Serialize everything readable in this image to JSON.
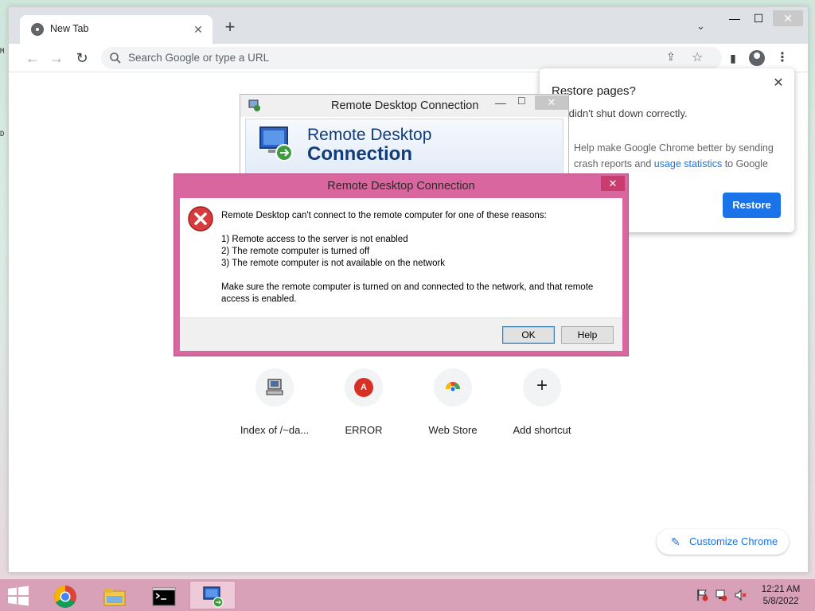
{
  "browser": {
    "tab": {
      "title": "New Tab",
      "close_glyph": "✕"
    },
    "new_tab_glyph": "+",
    "tab_search_glyph": "⌄",
    "window_controls": {
      "minimize": "—",
      "maximize": "☐",
      "close": "✕"
    },
    "omnibox": {
      "placeholder": "Search Google or type a URL"
    },
    "nav": {
      "back": "←",
      "forward": "→",
      "reload": "↻"
    },
    "icons": {
      "share": "⇪",
      "bookmark": "☆",
      "side_panel": "▮",
      "menu": "⋮"
    }
  },
  "ntp": {
    "shortcuts": [
      {
        "label": "Index of /~da...",
        "icon": "computer-icon"
      },
      {
        "label": "ERROR",
        "icon": "letter-a-icon",
        "badge": "A"
      },
      {
        "label": "Web Store",
        "icon": "chrome-web-store-icon"
      },
      {
        "label": "Add shortcut",
        "icon": "plus-icon",
        "glyph": "+"
      }
    ],
    "customize_label": "Customize Chrome",
    "customize_glyph": "✎"
  },
  "restore_popup": {
    "title": "Restore pages?",
    "message": "me didn't shut down correctly.",
    "help_prefix": "Help make Google Chrome better by sending crash reports and ",
    "help_link": "usage statistics",
    "help_suffix": " to Google",
    "button": "Restore",
    "close_glyph": "✕"
  },
  "rdc_window": {
    "title": "Remote Desktop Connection",
    "banner_line1": "Remote Desktop",
    "banner_line2": "Connection",
    "controls": {
      "minimize": "—",
      "maximize": "☐",
      "close": "✕"
    }
  },
  "error_dialog": {
    "title": "Remote Desktop Connection",
    "close_glyph": "✕",
    "intro": "Remote Desktop can't connect to the remote computer for one of these reasons:",
    "reasons": [
      "1) Remote access to the server is not enabled",
      "2) The remote computer is turned off",
      "3) The remote computer is not available on the network"
    ],
    "advice_line1": "Make sure the remote computer is turned on and connected to the network, and that remote",
    "advice_line2": "access is enabled.",
    "ok_label": "OK",
    "help_label": "Help"
  },
  "taskbar": {
    "apps": [
      "chrome-icon",
      "file-explorer-icon",
      "command-prompt-icon",
      "remote-desktop-icon"
    ],
    "tray": [
      "action-center-flag-icon",
      "network-icon",
      "volume-muted-icon"
    ],
    "time": "12:21 AM",
    "date": "5/8/2022"
  },
  "desktop": {
    "edge_glyph_1": "M",
    "edge_glyph_2": "D"
  },
  "colors": {
    "chrome_blue": "#1a73e8",
    "dialog_frame": "#d9669e",
    "taskbar": "#d9a1b7"
  }
}
